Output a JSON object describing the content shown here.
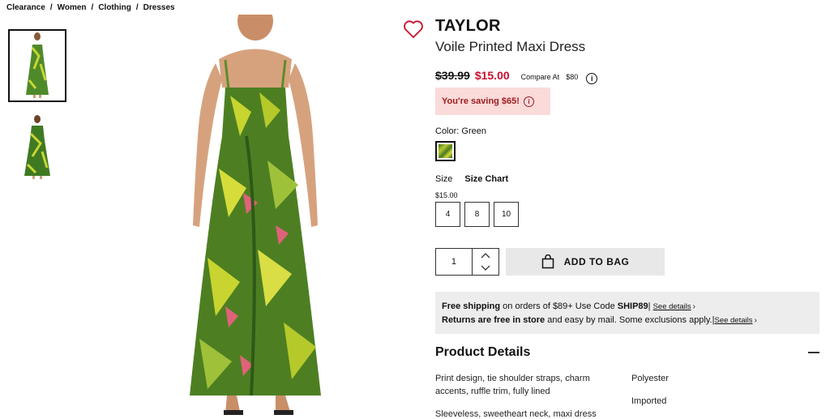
{
  "breadcrumb": [
    "Clearance",
    "Women",
    "Clothing",
    "Dresses"
  ],
  "breadcrumb_sep": "/",
  "product": {
    "brand": "TAYLOR",
    "name": "Voile Printed Maxi Dress",
    "old_price": "$39.99",
    "new_price": "$15.00",
    "compare_label": "Compare At",
    "compare_value": "$80",
    "saving_text": "You're saving $65!",
    "color_label": "Color:",
    "color_value": "Green",
    "size_label": "Size",
    "size_chart_label": "Size Chart",
    "size_price": "$15.00",
    "sizes": [
      "4",
      "8",
      "10"
    ],
    "quantity": "1",
    "add_to_bag_label": "ADD TO BAG"
  },
  "shipping": {
    "free_shipping_bold": "Free shipping",
    "free_shipping_text": " on orders of $89+ Use Code ",
    "code": "SHIP89",
    "see_details": "See details",
    "returns_bold": "Returns are free in store",
    "returns_text": " and easy by mail. Some exclusions apply.",
    "see_details_2": "See details"
  },
  "details": {
    "title": "Product Details",
    "left": [
      "Print design, tie shoulder straps, charm accents, ruffle trim, fully lined",
      "Sleeveless, sweetheart neck, maxi dress"
    ],
    "right": [
      "Polyester",
      "Imported"
    ]
  },
  "colors": {
    "sale_red": "#c8102e",
    "saving_bg": "#fbdada",
    "saving_text": "#9b1c1c",
    "info_bg": "#ededed",
    "add_bag_bg": "#e8e8e8"
  },
  "icons": [
    "heart-icon",
    "info-icon",
    "bag-icon",
    "chevron-up-icon",
    "chevron-down-icon",
    "chevron-right-icon",
    "collapse-icon"
  ]
}
